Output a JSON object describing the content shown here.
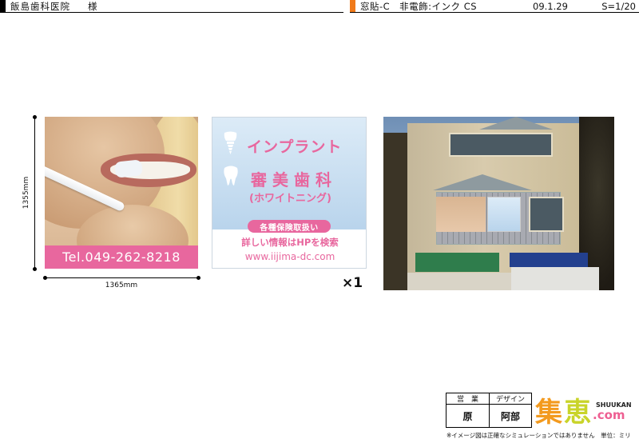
{
  "header": {
    "client": "飯島歯科医院",
    "sama": "様",
    "job": "窓貼-C　非電飾:インク CS",
    "date": "09.1.29",
    "scale": "S=1/20"
  },
  "panel1": {
    "tel": "Tel.049-262-8218"
  },
  "dimensions": {
    "height": "1355mm",
    "width": "1365mm"
  },
  "panel2": {
    "implant": "インプラント",
    "clinic": "審美歯科",
    "whitening": "(ホワイトニング)",
    "insurance": "各種保険取扱い",
    "info": "詳しい情報はHPを検索",
    "url": "www.iijima-dc.com"
  },
  "quantity": "×1",
  "stamp": {
    "sales_label": "営　業",
    "design_label": "デザイン",
    "sales_name": "原",
    "design_name": "阿部"
  },
  "logo": {
    "kanji1": "集",
    "kanji2": "恵",
    "en": "SHUUKAN",
    "com": ".com"
  },
  "footer_note": "※イメージ図は正確なシミュレーションではありません　単位：ミリ",
  "colors": {
    "pink": "#e8679e",
    "sky": "#b9d4ec",
    "header_orange": "#f07a1a"
  }
}
